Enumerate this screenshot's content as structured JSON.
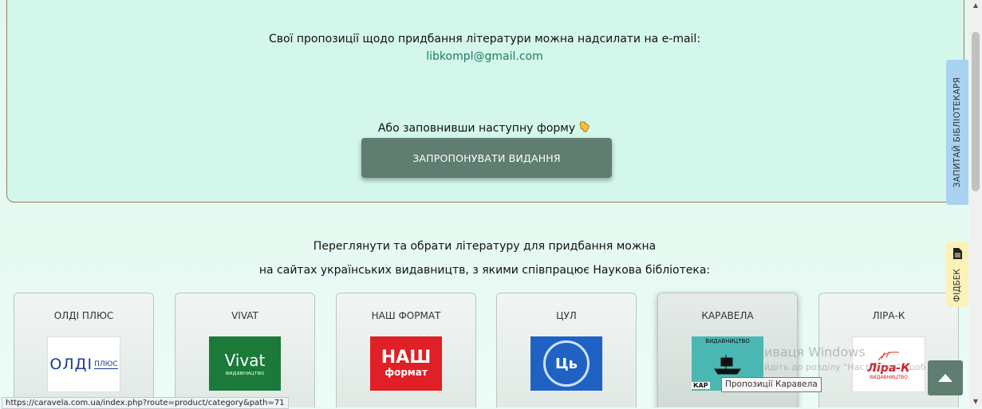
{
  "suggestion_box": {
    "line1": "Свої пропозиції щодо придбання літератури можна надсилати на e-mail:",
    "email": "libkompl@gmail.com",
    "line2": "Або заповнивши наступну форму",
    "hand_icon": "pointing-hand-down-icon",
    "button_label": "ЗАПРОПОНУВАТИ ВИДАННЯ"
  },
  "publishers_intro": {
    "line1": "Переглянути та обрати літературу для придбання можна",
    "line2": "на сайтах українських видавництв, з якими співпрацює Наукова бібліотека:"
  },
  "publishers": [
    {
      "name": "ОЛДІ ПЛЮС",
      "logo_text": "ОЛДІ",
      "logo_text2": "ПЛЮС"
    },
    {
      "name": "VIVAT",
      "logo_text": "Vivat",
      "logo_sub": "видавництво"
    },
    {
      "name": "НАШ ФОРМАТ",
      "logo_text": "НАШ",
      "logo_text2": "формат"
    },
    {
      "name": "ЦУЛ",
      "logo_text": "Ць"
    },
    {
      "name": "КАРАВЕЛА",
      "logo_text": "ВИДАВНИЦТВО",
      "logo_text2": "КАР"
    },
    {
      "name": "ЛІРА-К",
      "logo_text": "Ліра-К",
      "logo_sub": "ВИДАВНИЦТВО"
    }
  ],
  "side_tabs": {
    "librarian": "ЗАПИТАЙ БІБЛІОТЕКАРЯ",
    "feedback": "ФІДБЕК"
  },
  "colors": {
    "accent": "#5f7d70",
    "email": "#1f7a6a",
    "box_bg": "#d3f7ea",
    "librarian_tab": "#a9d2f0",
    "feedback_tab": "#fbf1b9"
  },
  "status_bar_url": "https://caravela.com.ua/index.php?route=product/category&path=71",
  "tooltip": "Пропозиції Каравела",
  "windows_watermark": {
    "line1": "иваця Windows",
    "line2": "йдіть до розділу \"Настройки\", щоб"
  }
}
